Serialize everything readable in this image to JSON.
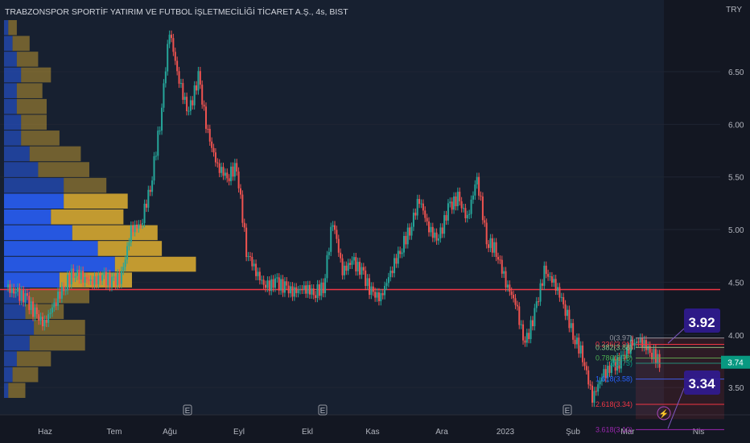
{
  "header": {
    "title": "TRABZONSPOR SPORTİF YATIRIM VE FUTBOL İŞLETMECİLİĞİ TİCARET A.Ş., 4s, BIST",
    "currency": "TRY"
  },
  "chart_data": {
    "type": "candlestick",
    "title": "TRABZONSPOR SPORTİF YATIRIM VE FUTBOL İŞLETMECİLİĞİ TİCARET A.Ş., 4s, BIST",
    "x_ticks": [
      "Haz",
      "Tem",
      "Ağu",
      "Eyl",
      "Ekl",
      "Kas",
      "Ara",
      "2023",
      "Şub",
      "Mar",
      "Nis"
    ],
    "y_ticks": [
      "6.50",
      "6.00",
      "5.50",
      "5.00",
      "4.50",
      "4.00",
      "3.50"
    ],
    "ylim": [
      3.2,
      7.0
    ],
    "close": [
      4.45,
      4.4,
      4.35,
      4.2,
      4.1,
      4.3,
      4.45,
      4.6,
      4.55,
      4.5,
      4.55,
      4.5,
      4.55,
      5.0,
      5.05,
      5.4,
      6.0,
      6.9,
      6.4,
      6.1,
      6.45,
      5.9,
      5.6,
      5.5,
      5.6,
      4.8,
      4.6,
      4.45,
      4.5,
      4.45,
      4.4,
      4.45,
      4.4,
      4.45,
      5.1,
      4.6,
      4.7,
      4.6,
      4.4,
      4.35,
      4.6,
      4.8,
      5.0,
      5.3,
      5.0,
      4.9,
      5.2,
      5.3,
      5.1,
      5.5,
      4.9,
      4.8,
      4.5,
      4.3,
      3.9,
      4.2,
      4.6,
      4.5,
      4.3,
      4.0,
      3.8,
      3.4,
      3.6,
      3.7,
      3.75,
      3.9,
      3.95,
      3.85,
      3.74
    ],
    "last_price": "3.74",
    "horizontal_line": 4.43,
    "fib_levels": [
      "0(3.97)",
      "0.236(3.91)",
      "0.382(3.88)",
      "0.786(3.78)",
      "1(3.73)",
      "1.618(3.58)",
      "2.618(3.34)",
      "3.618(3.10)"
    ],
    "targets": [
      "3.92",
      "3.34"
    ],
    "volume_profile": {
      "buy": [
        1,
        2,
        3,
        4,
        3,
        3,
        4,
        4,
        6,
        8,
        14,
        14,
        11,
        16,
        22,
        26,
        13,
        6,
        5,
        7,
        6,
        3,
        2,
        1
      ],
      "sell": [
        2,
        4,
        5,
        7,
        6,
        7,
        6,
        9,
        12,
        12,
        10,
        15,
        17,
        20,
        15,
        19,
        17,
        14,
        9,
        12,
        13,
        8,
        6,
        4
      ]
    },
    "colors": {
      "up": "#26a69a",
      "down": "#ef5350",
      "line": "#f23645",
      "buy": "#2962ff",
      "sell": "#e0b030",
      "last": "#089981",
      "target": "#311b92"
    }
  }
}
